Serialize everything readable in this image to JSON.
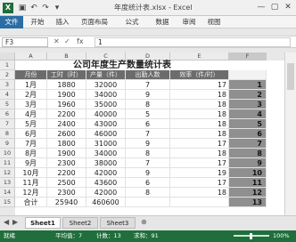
{
  "window": {
    "title": "年度统计表.xlsx - Excel",
    "app_icon_letter": "X",
    "min": "—",
    "restore": "▢",
    "close": "✕"
  },
  "ribbon": {
    "tabs": [
      "文件",
      "开始",
      "插入",
      "页面布局",
      "公式",
      "数据",
      "审阅",
      "视图"
    ]
  },
  "formula_bar": {
    "name_box": "F3",
    "fx": "fx",
    "cancel": "✕",
    "enter": "✓",
    "value": "1"
  },
  "columns": [
    "A",
    "B",
    "C",
    "D",
    "E",
    "F"
  ],
  "rows": [
    "1",
    "2",
    "3",
    "4",
    "5",
    "6",
    "7",
    "8",
    "9",
    "10",
    "11",
    "12",
    "13",
    "14",
    "15"
  ],
  "sheet_title": "公司年度生产数量统计表",
  "headers": [
    "月份",
    "工时（时）",
    "产量（件）",
    "出勤人数",
    "效率（件/时）",
    ""
  ],
  "table_rows": [
    [
      "1月",
      "1880",
      "32000",
      "7",
      "17",
      "1"
    ],
    [
      "2月",
      "1900",
      "34000",
      "9",
      "18",
      "2"
    ],
    [
      "3月",
      "1960",
      "35000",
      "8",
      "18",
      "3"
    ],
    [
      "4月",
      "2200",
      "40000",
      "5",
      "18",
      "4"
    ],
    [
      "5月",
      "2400",
      "43000",
      "6",
      "18",
      "5"
    ],
    [
      "6月",
      "2600",
      "46000",
      "7",
      "18",
      "6"
    ],
    [
      "7月",
      "1800",
      "31000",
      "9",
      "17",
      "7"
    ],
    [
      "8月",
      "1900",
      "34000",
      "8",
      "18",
      "8"
    ],
    [
      "9月",
      "2300",
      "38000",
      "7",
      "17",
      "9"
    ],
    [
      "10月",
      "2200",
      "42000",
      "9",
      "19",
      "10"
    ],
    [
      "11月",
      "2500",
      "43600",
      "6",
      "17",
      "11"
    ],
    [
      "12月",
      "2300",
      "42000",
      "8",
      "18",
      "12"
    ],
    [
      "合计",
      "25940",
      "460600",
      "",
      "",
      "13"
    ]
  ],
  "sheets": [
    "Sheet1",
    "Sheet2",
    "Sheet3"
  ],
  "status": {
    "ready": "就绪",
    "average": "平均值：7",
    "count": "计数：13",
    "sum": "求和：91",
    "zoom": "100%"
  },
  "colors": {
    "header_bg": "#6c6c6c",
    "selection": "#8f8f8f",
    "status_green": "#1f6e3b"
  }
}
